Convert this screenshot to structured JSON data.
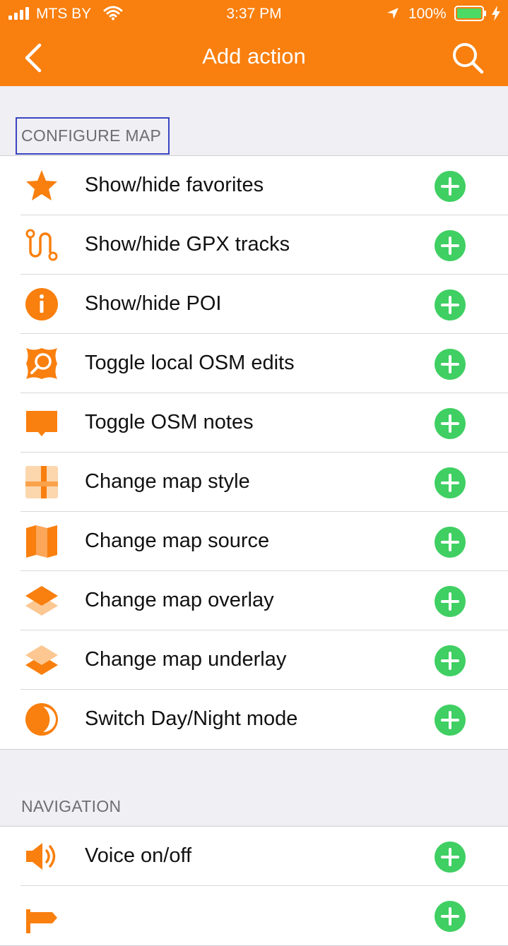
{
  "status_bar": {
    "carrier": "MTS BY",
    "time": "3:37 PM",
    "battery": "100%"
  },
  "nav": {
    "title": "Add action",
    "back_icon": "chevron-left-icon",
    "search_icon": "search-icon"
  },
  "colors": {
    "accent": "#f97f0e",
    "add_green": "#3fcf62",
    "header_text": "#6d6d72",
    "background": "#efeff4"
  },
  "sections": [
    {
      "title": "CONFIGURE MAP",
      "items": [
        {
          "label": "Show/hide favorites",
          "icon": "star-icon"
        },
        {
          "label": "Show/hide GPX tracks",
          "icon": "gpx-track-icon"
        },
        {
          "label": "Show/hide POI",
          "icon": "info-icon"
        },
        {
          "label": "Toggle local OSM edits",
          "icon": "osm-edits-icon"
        },
        {
          "label": "Toggle OSM notes",
          "icon": "note-bubble-icon"
        },
        {
          "label": "Change map style",
          "icon": "map-style-icon"
        },
        {
          "label": "Change map source",
          "icon": "map-icon"
        },
        {
          "label": "Change map overlay",
          "icon": "layers-overlay-icon"
        },
        {
          "label": "Change map underlay",
          "icon": "layers-underlay-icon"
        },
        {
          "label": "Switch Day/Night mode",
          "icon": "day-night-icon"
        }
      ]
    },
    {
      "title": "NAVIGATION",
      "items": [
        {
          "label": "Voice on/off",
          "icon": "speaker-icon"
        },
        {
          "label": "",
          "icon": "navigation-icon"
        }
      ]
    }
  ]
}
